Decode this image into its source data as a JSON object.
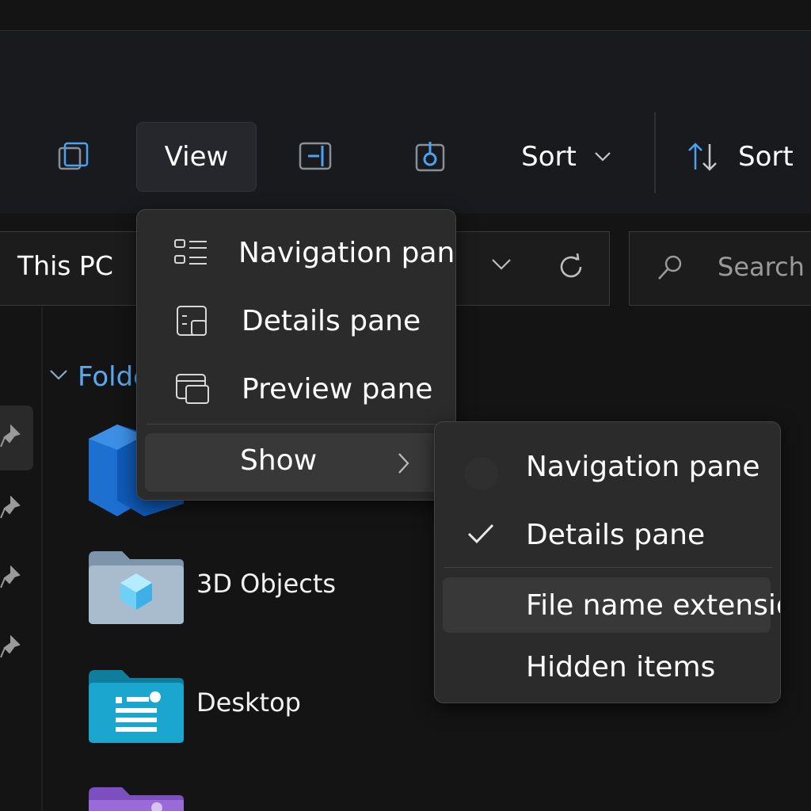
{
  "toolbar": {
    "view_label": "View",
    "sort_label": "Sort",
    "sort_label_2": "Sort"
  },
  "address": {
    "location": "This PC"
  },
  "search": {
    "placeholder": "Search"
  },
  "folders": {
    "header": "Folders",
    "items": [
      {
        "name": "",
        "icon": "blue-stack-folder-icon"
      },
      {
        "name": "3D Objects",
        "icon": "3d-objects-folder-icon"
      },
      {
        "name": "Desktop",
        "icon": "desktop-folder-icon"
      },
      {
        "name": "",
        "icon": "purple-folder-icon"
      }
    ]
  },
  "view_menu": {
    "items": [
      {
        "label": "Navigation pane",
        "icon": "navigation-pane-icon"
      },
      {
        "label": "Details pane",
        "icon": "details-pane-icon"
      },
      {
        "label": "Preview pane",
        "icon": "preview-pane-icon"
      }
    ],
    "show_label": "Show"
  },
  "show_menu": {
    "items": [
      {
        "label": "Navigation pane",
        "checked": false
      },
      {
        "label": "Details pane",
        "checked": true
      },
      {
        "label": "File name extensions",
        "checked": false
      },
      {
        "label": "Hidden items",
        "checked": false
      }
    ]
  },
  "colors": {
    "accent": "#5aa9f0",
    "menu_bg": "#2b2b2b",
    "toolbar_bg": "#191a1e"
  }
}
